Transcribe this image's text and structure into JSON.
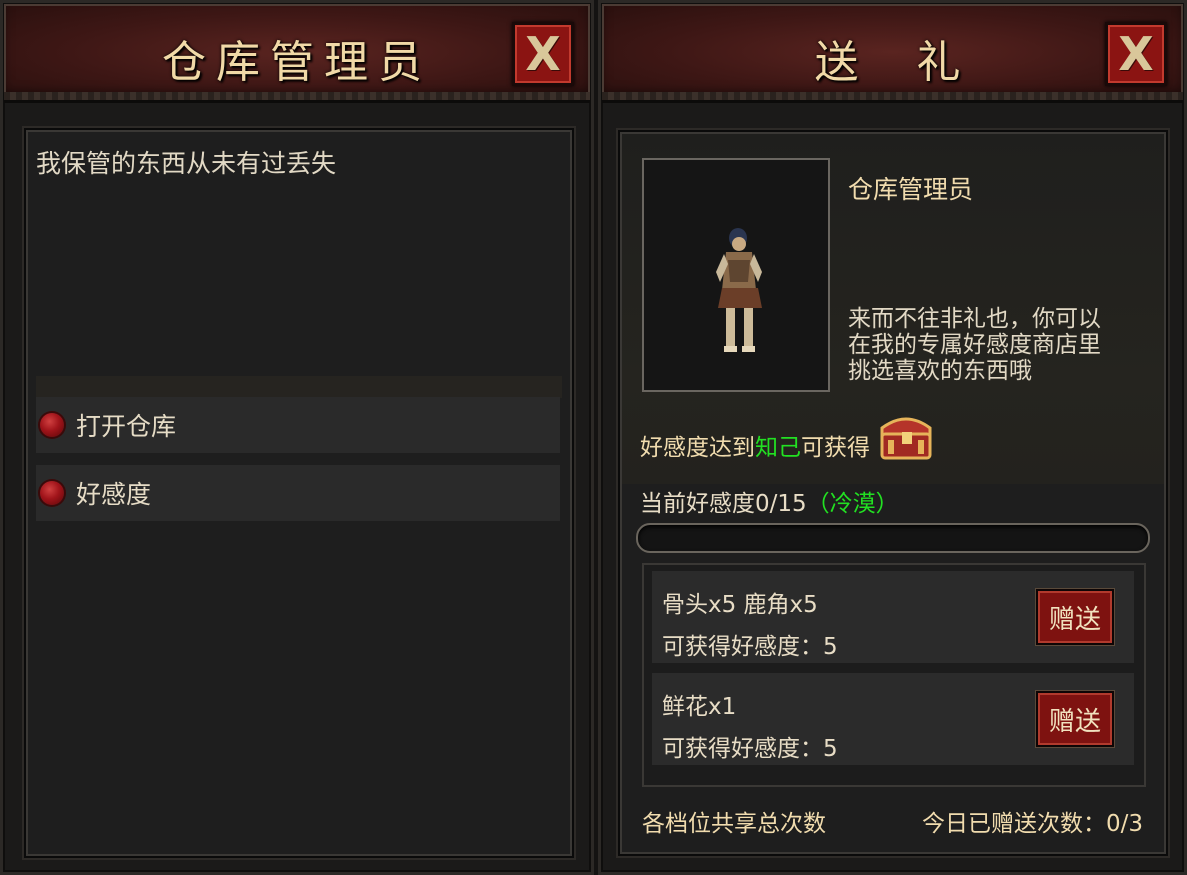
{
  "left": {
    "title": "仓库管理员",
    "close_label": "X",
    "dialogue": "我保管的东西从未有过丢失",
    "menu": [
      {
        "label": "打开仓库"
      },
      {
        "label": "好感度"
      }
    ]
  },
  "right": {
    "title": "送  礼",
    "close_label": "X",
    "npc_name": "仓库管理员",
    "description_lines": [
      "来而不往非礼也，你可以",
      "在我的专属好感度商店里",
      "挑选喜欢的东西哦"
    ],
    "reward": {
      "prefix": "好感度达到",
      "level": "知己",
      "suffix": "可获得"
    },
    "current": {
      "label": "当前好感度0/15",
      "status": "（冷漠）"
    },
    "progress_fraction": 0,
    "gifts": [
      {
        "items": "骨头x5 鹿角x5",
        "gain": "可获得好感度：5",
        "button": "赠送"
      },
      {
        "items": "鲜花x1",
        "gain": "可获得好感度：5",
        "button": "赠送"
      }
    ],
    "footer_left": "各档位共享总次数",
    "footer_right": "今日已赠送次数：0/3"
  },
  "colors": {
    "accent_green": "#22e022",
    "title_gold": "#f1d9a7",
    "button_red": "#8b1412"
  },
  "icons": {
    "close": "x-icon",
    "menu_bullet": "red-orb-icon",
    "reward": "treasure-chest-icon"
  }
}
